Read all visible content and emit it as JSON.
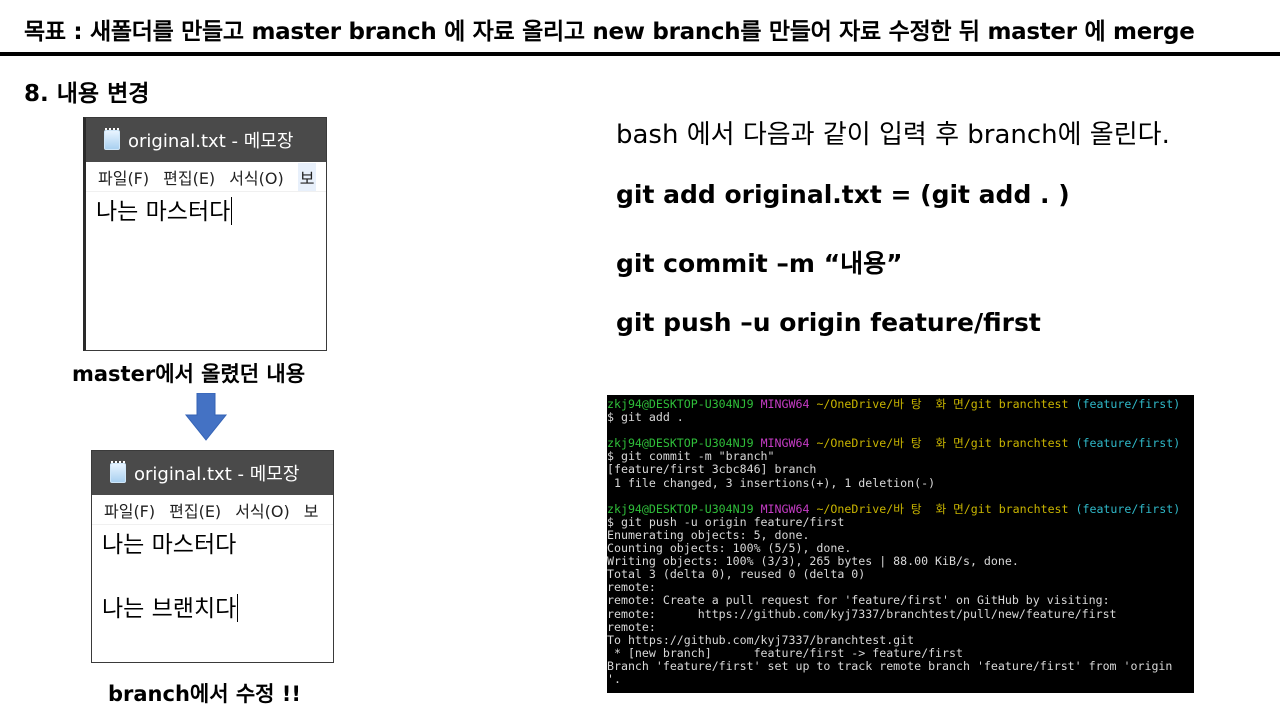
{
  "slide": {
    "title": "목표 : 새폴더를 만들고 master branch 에 자료 올리고 new branch를 만들어 자료 수정한 뒤 master 에 merge",
    "section_heading": "8. 내용 변경"
  },
  "notepad_master": {
    "window_title": "original.txt - 메모장",
    "menu": [
      "파일(F)",
      "편집(E)",
      "서식(O)",
      "보"
    ],
    "lines": [
      "나는 마스터다"
    ],
    "caption": "master에서 올렸던 내용"
  },
  "notepad_branch": {
    "window_title": "original.txt - 메모장",
    "menu": [
      "파일(F)",
      "편집(E)",
      "서식(O)",
      "보"
    ],
    "lines": [
      "나는 마스터다",
      "",
      "나는 브랜치다"
    ],
    "caption": "branch에서 수정 !!"
  },
  "instructions": {
    "intro": "bash 에서 다음과 같이 입력 후 branch에 올린다.",
    "cmd_add": "git add original.txt = (git add . )",
    "cmd_commit": "git commit –m “내용”",
    "cmd_push": "git push –u origin feature/first"
  },
  "terminal": {
    "prompt_user": "zkj94@DESKTOP-U304NJ9",
    "prompt_env": "MINGW64",
    "prompt_path": "~/OneDrive/바 탕  화 면/git branchtest",
    "prompt_branch": "(feature/first)",
    "cmd1": "$ git add .",
    "cmd2": "$ git commit -m \"branch\"",
    "out2": [
      "[feature/first 3cbc846] branch",
      " 1 file changed, 3 insertions(+), 1 deletion(-)"
    ],
    "cmd3": "$ git push -u origin feature/first",
    "out3": [
      "Enumerating objects: 5, done.",
      "Counting objects: 100% (5/5), done.",
      "Writing objects: 100% (3/3), 265 bytes | 88.00 KiB/s, done.",
      "Total 3 (delta 0), reused 0 (delta 0)",
      "remote:",
      "remote: Create a pull request for 'feature/first' on GitHub by visiting:",
      "remote:      https://github.com/kyj7337/branchtest/pull/new/feature/first",
      "remote:",
      "To https://github.com/kyj7337/branchtest.git",
      " * [new branch]      feature/first -> feature/first",
      "Branch 'feature/first' set up to track remote branch 'feature/first' from 'origin",
      "'."
    ]
  },
  "colors": {
    "arrow": "#4472c4",
    "titlebar": "#4a4a4a",
    "terminal_bg": "#000000"
  }
}
